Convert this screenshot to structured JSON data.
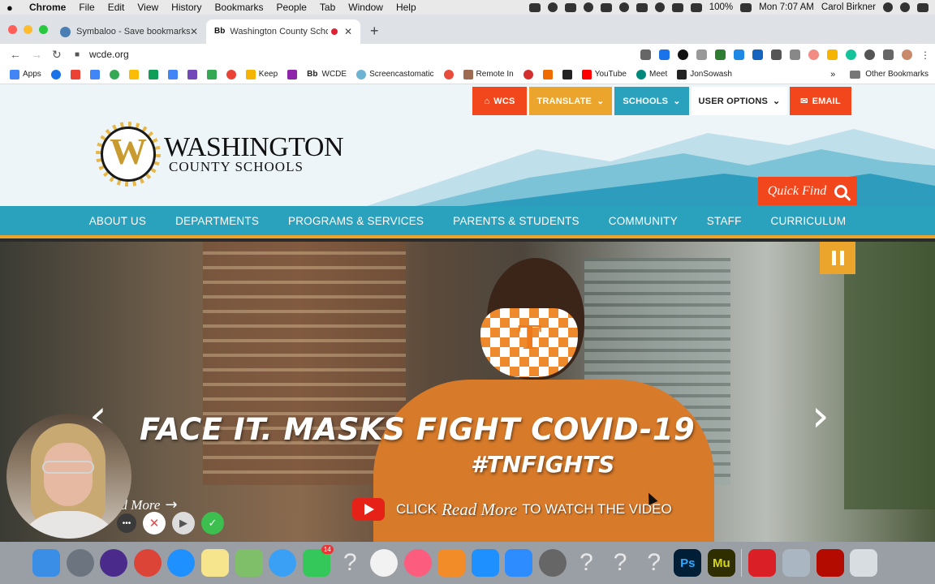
{
  "menubar": {
    "app": "Chrome",
    "items": [
      "File",
      "Edit",
      "View",
      "History",
      "Bookmarks",
      "People",
      "Tab",
      "Window",
      "Help"
    ],
    "battery": "100%",
    "clock": "Mon 7:07 AM",
    "user": "Carol Birkner"
  },
  "tabs": [
    {
      "title": "Symbaloo - Save bookmarks a",
      "close": "✕"
    },
    {
      "title": "Washington County Schoo",
      "close": "✕",
      "favicon_text": "Bb"
    }
  ],
  "newtab": "+",
  "toolbar": {
    "url": "wcde.org"
  },
  "bookmarks": {
    "apps": "Apps",
    "keep": "Keep",
    "wcde_label": "WCDE",
    "wcde_favicon": "Bb",
    "screencast": "Screencastomatic",
    "remote": "Remote In",
    "youtube": "YouTube",
    "meet": "Meet",
    "jon": "JonSowash",
    "more": "»",
    "other": "Other Bookmarks"
  },
  "site": {
    "top_buttons": {
      "wcs": "WCS",
      "translate": "TRANSLATE",
      "schools": "SCHOOLS",
      "user_options": "USER OPTIONS",
      "email": "EMAIL"
    },
    "logo_line1": "WASHINGTON",
    "logo_line2": "COUNTY SCHOOLS",
    "logo_letter": "W",
    "quick_find": "Quick Find",
    "nav": [
      "ABOUT US",
      "DEPARTMENTS",
      "PROGRAMS & SERVICES",
      "PARENTS & STUDENTS",
      "COMMUNITY",
      "STAFF",
      "CURRICULUM"
    ]
  },
  "hero": {
    "headline": "FACE IT. MASKS FIGHT COVID-19",
    "hashtag": "#TNFIGHTS",
    "cta_click": "CLICK",
    "cta_read_more": "Read More",
    "cta_rest": "TO WATCH THE VIDEO",
    "read_more_partial": "ad More"
  },
  "recorder": {
    "more": "•••",
    "cancel": "✕",
    "done": "✓"
  },
  "dock": {
    "facetime_badge": "14",
    "ps_label": "Ps",
    "mu_label": "Mu"
  },
  "colors": {
    "orange": "#f2461c",
    "gold": "#eba42c",
    "teal": "#2aa1bd"
  }
}
